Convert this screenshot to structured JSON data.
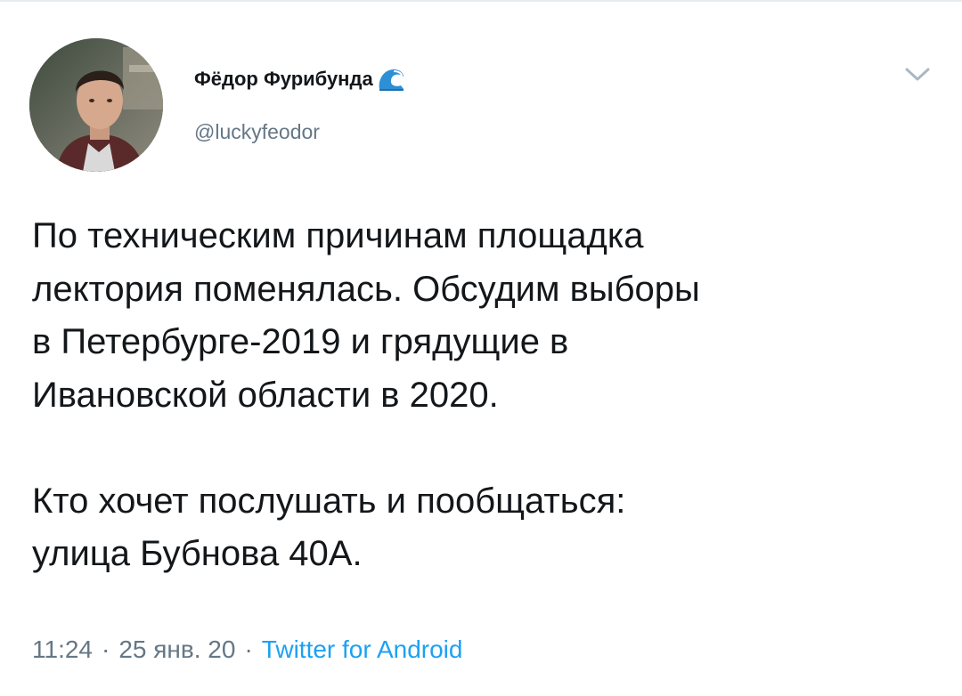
{
  "author": {
    "display_name": "Фёдор Фурибунда",
    "badge_icon": "wave-icon",
    "handle": "@luckyfeodor",
    "avatar": "profile-photo"
  },
  "menu": {
    "icon": "chevron-down-icon"
  },
  "tweet": {
    "paragraph1": [
      "По техническим причинам площадка",
      "лектория поменялась. Обсудим выборы",
      "в Петербурге-2019 и грядущие в",
      "Ивановской области в 2020."
    ],
    "paragraph2": [
      "Кто хочет послушать и пообщаться:",
      "улица Бубнова 40А."
    ]
  },
  "meta": {
    "time": "11:24",
    "separator": "·",
    "date": "25 янв. 20",
    "source": "Twitter for Android"
  },
  "colors": {
    "text": "#14171a",
    "secondary": "#657786",
    "link": "#1da1f2"
  }
}
